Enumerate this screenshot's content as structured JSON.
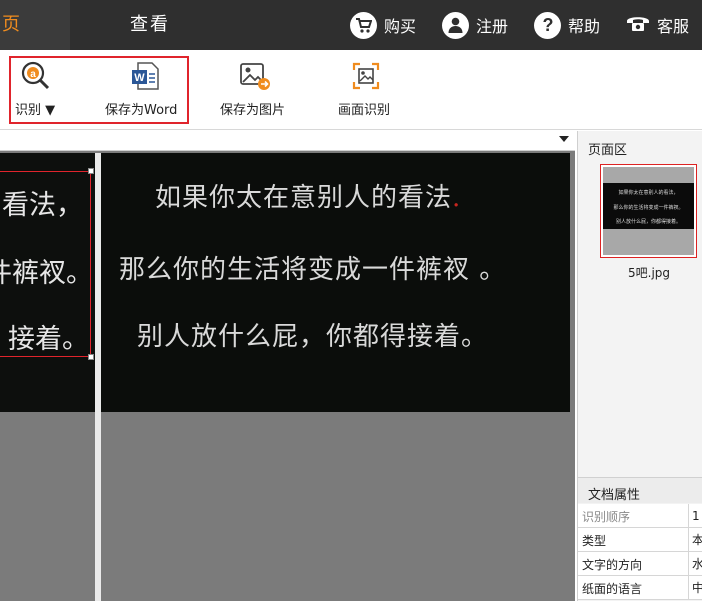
{
  "topbar": {
    "tab_page": "页",
    "tab_view": "查看",
    "buttons": [
      {
        "label": "购买",
        "icon": "cart-icon"
      },
      {
        "label": "注册",
        "icon": "user-icon"
      },
      {
        "label": "帮助",
        "icon": "help-icon"
      },
      {
        "label": "客服",
        "icon": "phone-icon"
      }
    ]
  },
  "toolbar": {
    "recognize_label": "识别 ▼",
    "save_word_label": "保存为Word",
    "save_image_label": "保存为图片",
    "screen_recognize_label": "画面识别"
  },
  "image": {
    "left_lines": [
      "看法，",
      "一件裤衩。",
      "接着。"
    ],
    "right_lines": [
      "如果你太在意别人的看法",
      "那么你的生活将变成一件裤衩 。",
      "别人放什么屁，你都得接着。"
    ],
    "right_line1_mark": "."
  },
  "right_panel": {
    "pages_title": "页面区",
    "thumb_lines": [
      "如果你太在意别人的看法，",
      "那么你的生活将变成一件裤衩。",
      "别人放什么屁，你都得接着。"
    ],
    "thumb_name": "5吧.jpg",
    "props_title": "文档属性",
    "props": [
      {
        "key": "识别顺序",
        "value": "1",
        "dim": true
      },
      {
        "key": "类型",
        "value": "本",
        "dim": false
      },
      {
        "key": "文字的方向",
        "value": "水",
        "dim": false
      },
      {
        "key": "纸面的语言",
        "value": "中",
        "dim": false
      }
    ]
  },
  "colors": {
    "accent": "#f08c1e",
    "topbar_bg": "#2f2f2f",
    "highlight_red": "#e0242c"
  }
}
